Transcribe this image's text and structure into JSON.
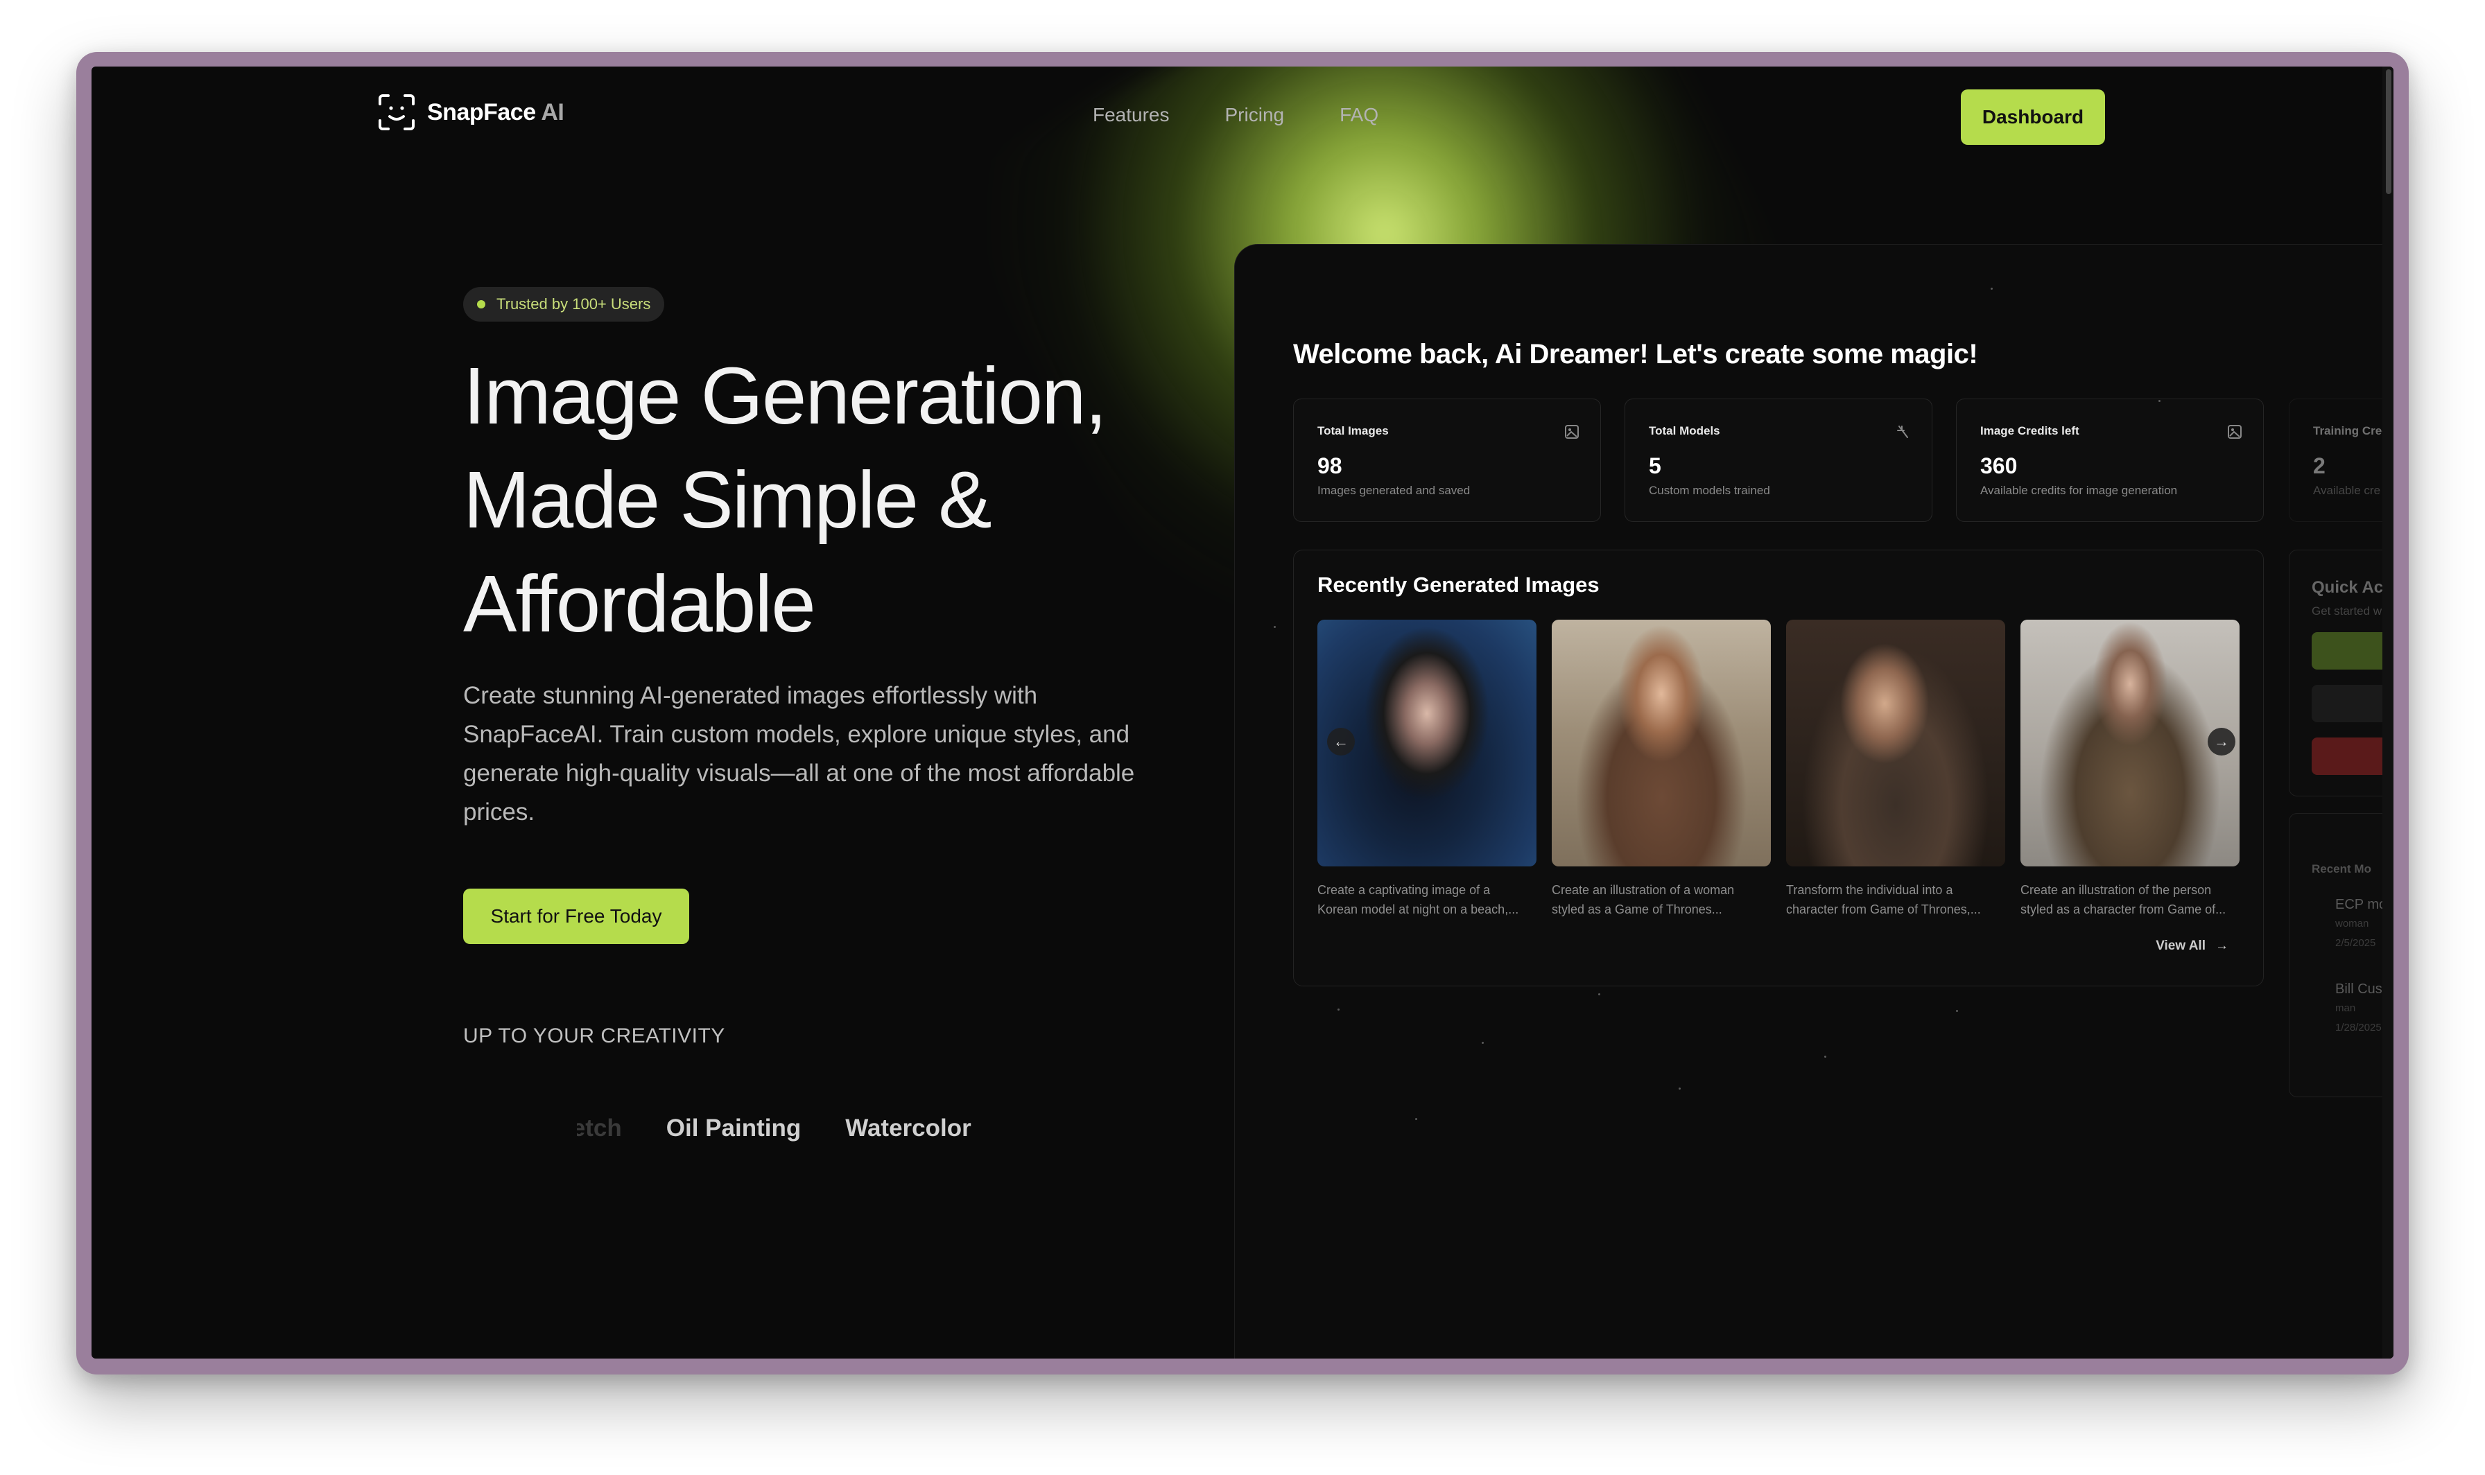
{
  "nav": {
    "brand_name": "SnapFace",
    "brand_suffix": "AI",
    "links": [
      "Features",
      "Pricing",
      "FAQ"
    ],
    "dashboard_label": "Dashboard"
  },
  "hero": {
    "badge": "Trusted by 100+ Users",
    "title_line1": "Image Generation,",
    "title_line2": "Made Simple &",
    "title_line3": "Affordable",
    "description": "Create stunning AI-generated images effortlessly with SnapFaceAI. Train custom models, explore unique styles, and generate high-quality visuals—all at one of the most affordable prices.",
    "cta_label": "Start for Free Today",
    "creativity_label": "UP TO YOUR CREATIVITY",
    "styles": [
      "Sketch",
      "Oil Painting",
      "Watercolor"
    ]
  },
  "dashboard": {
    "welcome": "Welcome back, Ai Dreamer! Let's create some magic!",
    "stats": [
      {
        "label": "Total Images",
        "value": "98",
        "sub": "Images generated and saved",
        "icon": "image-icon"
      },
      {
        "label": "Total Models",
        "value": "5",
        "sub": "Custom models trained",
        "icon": "sparkle-icon"
      },
      {
        "label": "Image Credits left",
        "value": "360",
        "sub": "Available credits for image generation",
        "icon": "image-icon"
      },
      {
        "label": "Training Cred",
        "value": "2",
        "sub": "Available cre",
        "icon": ""
      }
    ],
    "recent_title": "Recently Generated Images",
    "recent_images": [
      {
        "caption1": "Create a captivating image of a",
        "caption2": "Korean model at night on a beach,..."
      },
      {
        "caption1": "Create an illustration of a woman",
        "caption2": "styled as a Game of Thrones..."
      },
      {
        "caption1": "Transform the individual into a",
        "caption2": "character from Game of Thrones,..."
      },
      {
        "caption1": "Create an illustration of the person",
        "caption2": "styled as a character from Game of..."
      }
    ],
    "view_all": "View All",
    "quick_actions": {
      "title": "Quick Acti",
      "sub": "Get started w"
    },
    "recent_models": {
      "title": "Recent Mo",
      "items": [
        {
          "name": "ECP mo",
          "type": "woman",
          "date": "2/5/2025"
        },
        {
          "name": "Bill Cust",
          "type": "man",
          "date": "1/28/2025"
        }
      ]
    }
  }
}
